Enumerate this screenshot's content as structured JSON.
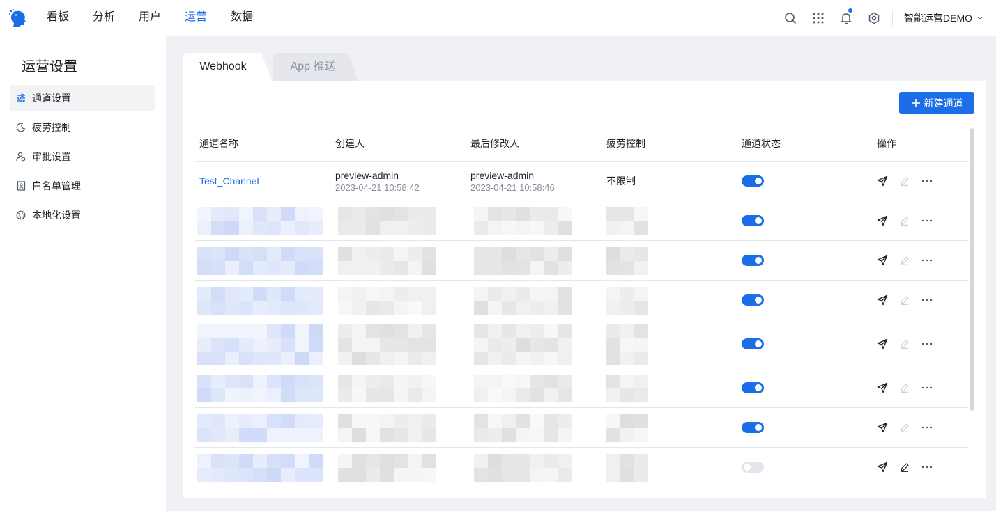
{
  "nav": {
    "items": [
      "看板",
      "分析",
      "用户",
      "运营",
      "数据"
    ],
    "active_index": 3,
    "account": "智能运营DEMO"
  },
  "sidebar": {
    "title": "运营设置",
    "items": [
      {
        "label": "通道设置",
        "icon": "sliders-icon"
      },
      {
        "label": "疲劳控制",
        "icon": "moon-icon"
      },
      {
        "label": "审批设置",
        "icon": "user-approve-icon"
      },
      {
        "label": "白名单管理",
        "icon": "contact-card-icon"
      },
      {
        "label": "本地化设置",
        "icon": "globe-icon"
      }
    ],
    "active_index": 0
  },
  "tabs": [
    "Webhook",
    "App 推送"
  ],
  "active_tab": 0,
  "actions": {
    "new_channel": "新建通道"
  },
  "table": {
    "columns": [
      "通道名称",
      "创建人",
      "最后修改人",
      "疲劳控制",
      "通道状态",
      "操作"
    ],
    "rows": [
      {
        "name": "Test_Channel",
        "creator": "preview-admin",
        "created_at": "2023-04-21 10:58:42",
        "modifier": "preview-admin",
        "modified_at": "2023-04-21 10:58:46",
        "fatigue": "不限制",
        "enabled": true
      },
      {
        "name": "",
        "creator": "",
        "created_at": "",
        "modifier": "",
        "modified_at": "",
        "fatigue": "",
        "enabled": true
      },
      {
        "name": "",
        "creator": "",
        "created_at": "",
        "modifier": "",
        "modified_at": "",
        "fatigue": "",
        "enabled": true
      },
      {
        "name": "",
        "creator": "",
        "created_at": "",
        "modifier": "",
        "modified_at": "",
        "fatigue": "",
        "enabled": true
      },
      {
        "name": "",
        "creator": "",
        "created_at": "",
        "modifier": "",
        "modified_at": "",
        "fatigue": "",
        "enabled": true
      },
      {
        "name": "",
        "creator": "",
        "created_at": "",
        "modifier": "",
        "modified_at": "",
        "fatigue": "",
        "enabled": true
      },
      {
        "name": "",
        "creator": "",
        "created_at": "",
        "modifier": "",
        "modified_at": "",
        "fatigue": "",
        "enabled": true
      },
      {
        "name": "",
        "creator": "",
        "created_at": "",
        "modifier": "",
        "modified_at": "",
        "fatigue": "",
        "enabled": false
      }
    ]
  },
  "colors": {
    "accent": "#1b6ee8",
    "border": "#e5e6eb",
    "muted": "#86909c"
  }
}
